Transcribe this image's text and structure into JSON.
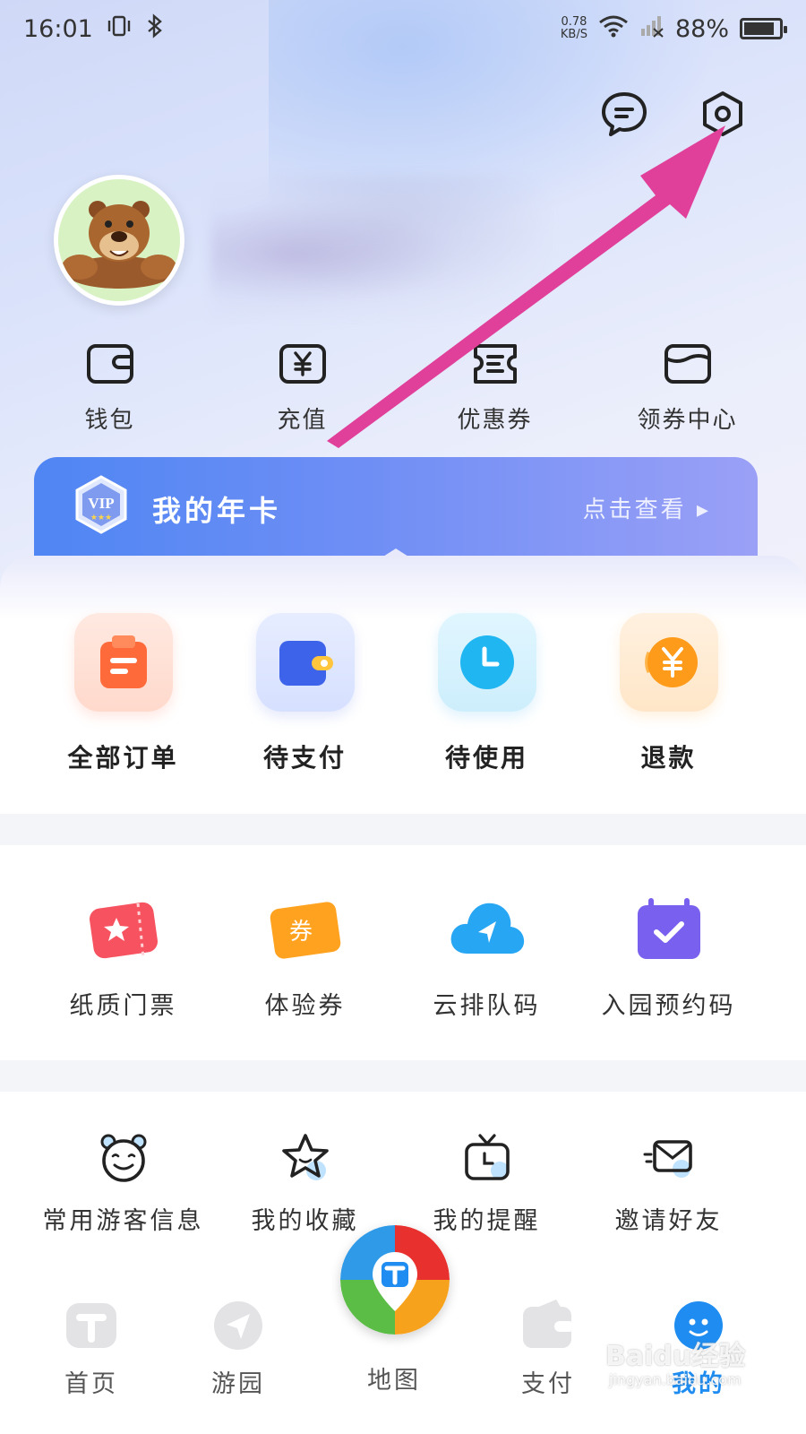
{
  "status_bar": {
    "time": "16:01",
    "net_speed_value": "0.78",
    "net_speed_unit": "KB/S",
    "battery": "88%"
  },
  "header": {
    "message_icon": "chat-bubble-icon",
    "settings_icon": "hexagon-gear-icon"
  },
  "quick_actions": [
    {
      "label": "钱包",
      "icon": "wallet-icon"
    },
    {
      "label": "充值",
      "icon": "yen-recharge-icon"
    },
    {
      "label": "优惠券",
      "icon": "coupon-icon"
    },
    {
      "label": "领券中心",
      "icon": "coupon-center-icon"
    }
  ],
  "vip_card": {
    "badge": "VIP",
    "title": "我的年卡",
    "link": "点击查看 ▸"
  },
  "orders": [
    {
      "label": "全部订单",
      "icon": "all-orders-icon",
      "color": "#ff6a3a"
    },
    {
      "label": "待支付",
      "icon": "pending-payment-wallet-icon",
      "color": "#3d63ea"
    },
    {
      "label": "待使用",
      "icon": "pending-use-clock-icon",
      "color": "#1fb6f2"
    },
    {
      "label": "退款",
      "icon": "refund-yen-icon",
      "color": "#ff9b1a"
    }
  ],
  "services": [
    {
      "label": "纸质门票",
      "icon": "paper-ticket-icon",
      "color": "#f6525f"
    },
    {
      "label": "体验券",
      "icon": "experience-voucher-icon",
      "color": "#ffa21f",
      "badge_text": "券"
    },
    {
      "label": "云排队码",
      "icon": "cloud-queue-icon",
      "color": "#27a6f4"
    },
    {
      "label": "入园预约码",
      "icon": "calendar-check-icon",
      "color": "#7a60ee"
    }
  ],
  "tools": [
    {
      "label": "常用游客信息",
      "icon": "bear-face-icon"
    },
    {
      "label": "我的收藏",
      "icon": "star-icon"
    },
    {
      "label": "我的提醒",
      "icon": "tv-clock-icon"
    },
    {
      "label": "邀请好友",
      "icon": "envelope-icon"
    }
  ],
  "tabbar": [
    {
      "label": "首页",
      "icon": "home-t-icon"
    },
    {
      "label": "游园",
      "icon": "navigate-arrow-icon"
    },
    {
      "label": "地图",
      "icon": "map-pin-icon"
    },
    {
      "label": "支付",
      "icon": "wallet-tab-icon"
    },
    {
      "label": "我的",
      "icon": "profile-face-icon",
      "active": true
    }
  ],
  "watermark": {
    "text": "Baidu经验",
    "sub": "jingyan.baidu.com"
  },
  "colors": {
    "accent": "#4f86f3",
    "arrow": "#e0409a",
    "active_tab": "#1e8cf0"
  }
}
